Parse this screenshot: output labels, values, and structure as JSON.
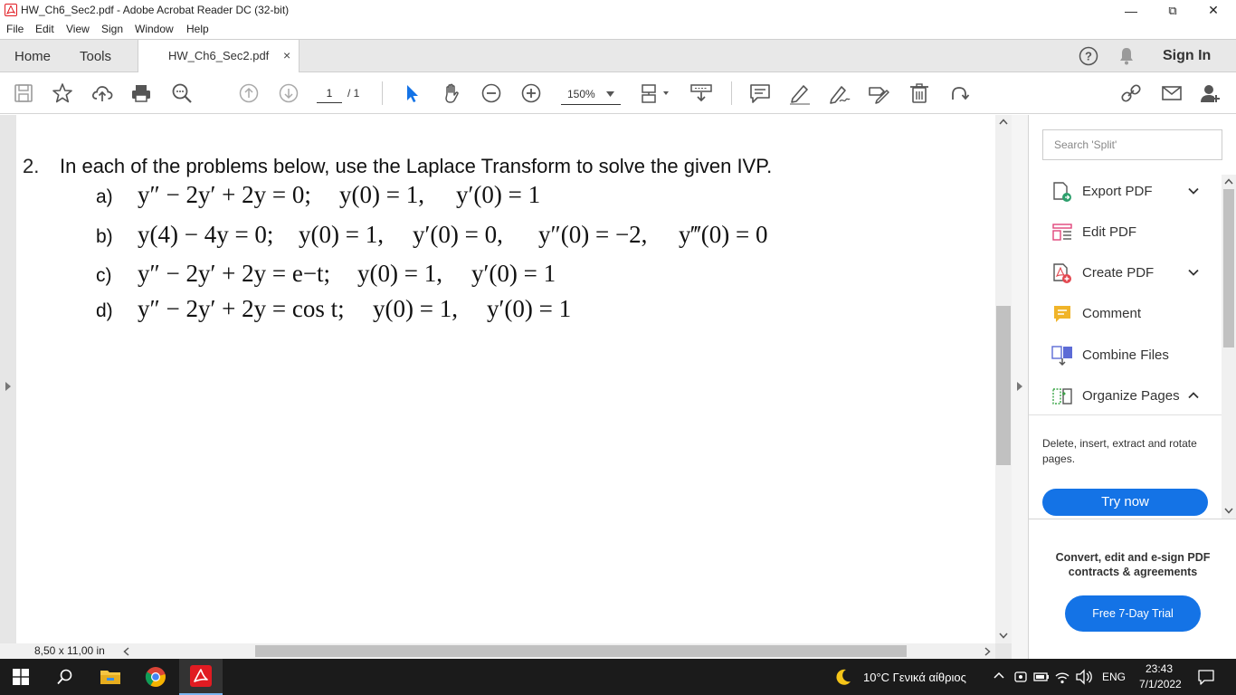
{
  "window": {
    "title": "HW_Ch6_Sec2.pdf - Adobe Acrobat Reader DC (32-bit)",
    "minimize": "—",
    "restore": "⧉",
    "close": "✕"
  },
  "menu": [
    "File",
    "Edit",
    "View",
    "Sign",
    "Window",
    "Help"
  ],
  "tabs": {
    "home": "Home",
    "tools": "Tools",
    "document": "HW_Ch6_Sec2.pdf",
    "close": "×",
    "sign_in": "Sign In"
  },
  "toolbar": {
    "page_current": "1",
    "page_total": "/ 1",
    "zoom": "150%"
  },
  "document": {
    "problem_number": "2.",
    "problem_text": "In each of the problems below, use the Laplace Transform to solve the given IVP.",
    "parts": [
      {
        "label": "a)",
        "equation": "y″ − 2y′ + 2y = 0;",
        "conditions": [
          "y(0) = 1,",
          "y′(0) = 1"
        ]
      },
      {
        "label": "b)",
        "equation": "y(4) − 4y = 0;",
        "conditions": [
          "y(0) = 1,",
          "y′(0) = 0,",
          "y″(0) = −2,",
          "y‴(0) = 0"
        ]
      },
      {
        "label": "c)",
        "equation": "y″ − 2y′ + 2y = e−t;",
        "conditions": [
          "y(0) = 1,",
          "y′(0) = 1"
        ]
      },
      {
        "label": "d)",
        "equation": "y″ − 2y′ + 2y = cos t;",
        "conditions": [
          "y(0) = 1,",
          "y′(0) = 1"
        ]
      }
    ],
    "page_size": "8,50 x 11,00 in"
  },
  "right_panel": {
    "search_placeholder": "Search 'Split'",
    "tools": [
      {
        "name": "Export PDF",
        "icon": "export-pdf-icon",
        "color": "#2d9f6c"
      },
      {
        "name": "Edit PDF",
        "icon": "edit-pdf-icon",
        "color": "#e0457b"
      },
      {
        "name": "Create PDF",
        "icon": "create-pdf-icon",
        "color": "#e34850"
      },
      {
        "name": "Comment",
        "icon": "comment-icon",
        "color": "#f0b429"
      },
      {
        "name": "Combine Files",
        "icon": "combine-files-icon",
        "color": "#5c6bd6"
      },
      {
        "name": "Organize Pages",
        "icon": "organize-pages-icon",
        "color": "#3aa547"
      }
    ],
    "organize_description": "Delete, insert, extract and rotate pages.",
    "try_now": "Try now",
    "promo_text": "Convert, edit and e-sign PDF contracts & agreements",
    "trial_button": "Free 7-Day Trial"
  },
  "taskbar": {
    "weather": "10°C  Γενικά αίθριος",
    "language": "ENG",
    "time": "23:43",
    "date": "7/1/2022"
  },
  "colors": {
    "accent": "#1473e6",
    "acrobat_red": "#e11b22"
  }
}
